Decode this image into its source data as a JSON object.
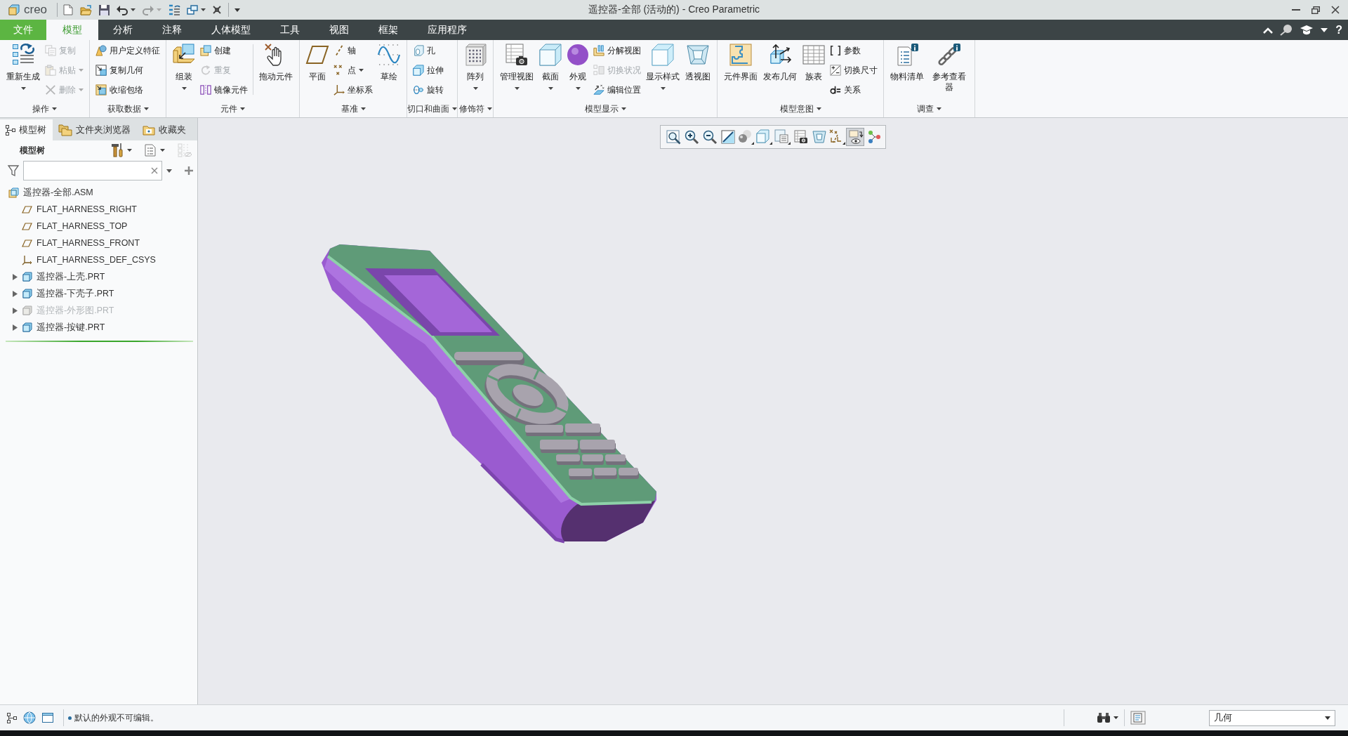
{
  "title_bar": {
    "logo": "creo",
    "quick_access": [
      {
        "disabled": false,
        "dropdown": false
      },
      {
        "disabled": false,
        "dropdown": false
      },
      {
        "disabled": false,
        "dropdown": false
      },
      {
        "disabled": false,
        "dropdown": true
      },
      {
        "disabled": true,
        "dropdown": true
      },
      {
        "disabled": false,
        "dropdown": false
      },
      {
        "disabled": false,
        "dropdown": true
      },
      {
        "disabled": false,
        "dropdown": false
      }
    ],
    "title": "遥控器-全部 (活动的) - Creo Parametric"
  },
  "menu": {
    "tabs": [
      {
        "label": "文件",
        "kind": "file",
        "selected": false
      },
      {
        "label": "模型",
        "kind": "tab",
        "selected": true
      },
      {
        "label": "分析",
        "kind": "tab",
        "selected": false
      },
      {
        "label": "注释",
        "kind": "tab",
        "selected": false
      },
      {
        "label": "人体模型",
        "kind": "tab",
        "selected": false
      },
      {
        "label": "工具",
        "kind": "tab",
        "selected": false
      },
      {
        "label": "视图",
        "kind": "tab",
        "selected": false
      },
      {
        "label": "框架",
        "kind": "tab",
        "selected": false
      },
      {
        "label": "应用程序",
        "kind": "tab",
        "selected": false
      }
    ],
    "help": "?"
  },
  "ribbon": {
    "groups": [
      {
        "label": "操作",
        "blocks": [
          {
            "kind": "large",
            "label": "重新生成",
            "dropdown": true,
            "disabled": false
          },
          {
            "kind": "stack",
            "items": [
              {
                "label": "复制",
                "dropdown": false,
                "disabled": true
              },
              {
                "label": "粘贴",
                "dropdown": true,
                "disabled": true
              },
              {
                "label": "删除",
                "dropdown": true,
                "disabled": true
              }
            ]
          }
        ]
      },
      {
        "label": "获取数据",
        "blocks": [
          {
            "kind": "stack",
            "items": [
              {
                "label": "用户定义特征",
                "dropdown": false,
                "disabled": false
              },
              {
                "label": "复制几何",
                "dropdown": false,
                "disabled": false
              },
              {
                "label": "收缩包络",
                "dropdown": false,
                "disabled": false
              }
            ]
          }
        ]
      },
      {
        "label": "元件",
        "blocks": [
          {
            "kind": "large",
            "label": "组装",
            "dropdown": true,
            "disabled": false
          },
          {
            "kind": "stack",
            "items": [
              {
                "label": "创建",
                "dropdown": false,
                "disabled": false
              },
              {
                "label": "重复",
                "dropdown": false,
                "disabled": true
              },
              {
                "label": "镜像元件",
                "dropdown": false,
                "disabled": false
              }
            ]
          },
          {
            "kind": "separator"
          },
          {
            "kind": "large",
            "label": "拖动元件",
            "dropdown": false,
            "disabled": false
          }
        ]
      },
      {
        "label": "基准",
        "blocks": [
          {
            "kind": "large",
            "label": "平面",
            "dropdown": false,
            "disabled": false
          },
          {
            "kind": "stack",
            "items": [
              {
                "label": "轴",
                "dropdown": false,
                "disabled": false
              },
              {
                "label": "点",
                "dropdown": true,
                "disabled": false
              },
              {
                "label": "坐标系",
                "dropdown": false,
                "disabled": false
              }
            ]
          },
          {
            "kind": "large",
            "label": "草绘",
            "dropdown": false,
            "disabled": false
          }
        ]
      },
      {
        "label": "切口和曲面",
        "blocks": [
          {
            "kind": "stack",
            "items": [
              {
                "label": "孔",
                "dropdown": false,
                "disabled": false
              },
              {
                "label": "拉伸",
                "dropdown": false,
                "disabled": false
              },
              {
                "label": "旋转",
                "dropdown": false,
                "disabled": false
              }
            ]
          }
        ]
      },
      {
        "label": "修饰符",
        "blocks": [
          {
            "kind": "large",
            "label": "阵列",
            "dropdown": true,
            "disabled": false
          }
        ]
      },
      {
        "label": "模型显示",
        "blocks": [
          {
            "kind": "large",
            "label": "管理视图",
            "dropdown": true,
            "disabled": false
          },
          {
            "kind": "large",
            "label": "截面",
            "dropdown": true,
            "disabled": false
          },
          {
            "kind": "large",
            "label": "外观",
            "dropdown": true,
            "disabled": false
          },
          {
            "kind": "stack",
            "items": [
              {
                "label": "分解视图",
                "dropdown": false,
                "disabled": false
              },
              {
                "label": "切换状况",
                "dropdown": false,
                "disabled": true
              },
              {
                "label": "编辑位置",
                "dropdown": false,
                "disabled": false
              }
            ]
          },
          {
            "kind": "large",
            "label": "显示样式",
            "dropdown": true,
            "disabled": false
          },
          {
            "kind": "large",
            "label": "透视图",
            "dropdown": false,
            "disabled": false
          }
        ]
      },
      {
        "label": "模型意图",
        "blocks": [
          {
            "kind": "large",
            "label": "元件界面",
            "dropdown": false,
            "disabled": false
          },
          {
            "kind": "large",
            "label": "发布几何",
            "dropdown": false,
            "disabled": false
          },
          {
            "kind": "large",
            "label": "族表",
            "dropdown": false,
            "disabled": false
          },
          {
            "kind": "stack",
            "items": [
              {
                "label": "参数",
                "dropdown": false,
                "disabled": false
              },
              {
                "label": "切换尺寸",
                "dropdown": false,
                "disabled": false
              },
              {
                "label": "关系",
                "dropdown": false,
                "disabled": false
              }
            ]
          }
        ]
      },
      {
        "label": "调查",
        "blocks": [
          {
            "kind": "large",
            "label": "物料清单",
            "dropdown": false,
            "disabled": false
          },
          {
            "kind": "large",
            "label": "参考查看器",
            "dropdown": false,
            "disabled": false
          }
        ]
      }
    ]
  },
  "model_tree": {
    "tabs": [
      {
        "label": "模型树",
        "selected": true
      },
      {
        "label": "文件夹浏览器",
        "selected": false
      },
      {
        "label": "收藏夹",
        "selected": false
      }
    ],
    "title": "模型树",
    "items": [
      {
        "label": "遥控器-全部.ASM",
        "kind": "assembly",
        "children": [
          {
            "label": "FLAT_HARNESS_RIGHT",
            "kind": "plane",
            "hidden": false
          },
          {
            "label": "FLAT_HARNESS_TOP",
            "kind": "plane",
            "hidden": false
          },
          {
            "label": "FLAT_HARNESS_FRONT",
            "kind": "plane",
            "hidden": false
          },
          {
            "label": "FLAT_HARNESS_DEF_CSYS",
            "kind": "csys",
            "hidden": false
          },
          {
            "label": "遥控器-上壳.PRT",
            "kind": "part",
            "expanded": false,
            "hidden": false
          },
          {
            "label": "遥控器-下壳子.PRT",
            "kind": "part",
            "expanded": false,
            "hidden": false
          },
          {
            "label": "遥控器-外形图.PRT",
            "kind": "part",
            "expanded": false,
            "hidden": true
          },
          {
            "label": "遥控器-按键.PRT",
            "kind": "part",
            "expanded": false,
            "hidden": false
          }
        ]
      }
    ]
  },
  "view_toolbar": {
    "buttons": [
      {
        "selected": false,
        "dropdown": false
      },
      {
        "selected": false,
        "dropdown": false
      },
      {
        "selected": false,
        "dropdown": false
      },
      {
        "selected": false,
        "dropdown": false
      },
      {
        "selected": false,
        "dropdown": true
      },
      {
        "selected": false,
        "dropdown": true
      },
      {
        "selected": false,
        "dropdown": true
      },
      {
        "selected": false,
        "dropdown": false
      },
      {
        "selected": false,
        "dropdown": false
      },
      {
        "selected": false,
        "dropdown": true
      },
      {
        "selected": true,
        "dropdown": false
      },
      {
        "selected": false,
        "dropdown": false
      }
    ]
  },
  "status_bar": {
    "message": "默认的外观不可编辑。",
    "selection_filter": "几何"
  }
}
